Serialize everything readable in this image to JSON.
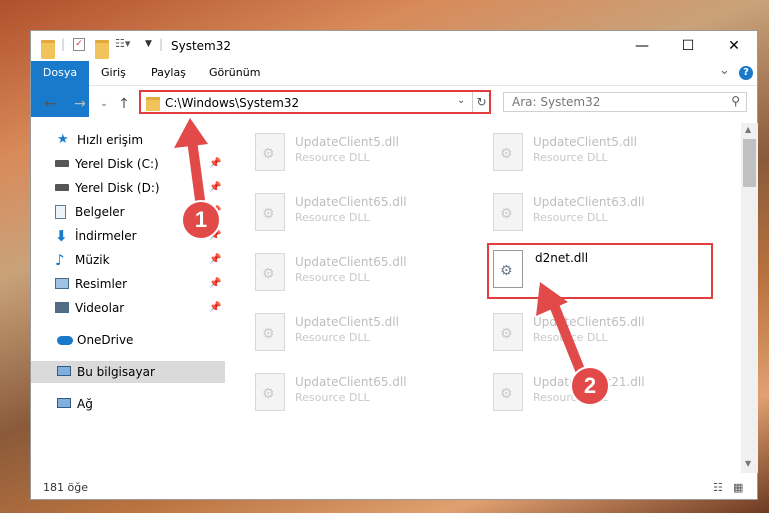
{
  "window": {
    "title": "System32",
    "controls": {
      "minimize": "—",
      "maximize": "☐",
      "close": "✕"
    }
  },
  "ribbon": {
    "tabs": [
      "Dosya",
      "Giriş",
      "Paylaş",
      "Görünüm"
    ],
    "collapse": "⌄",
    "help": "?"
  },
  "address": {
    "path": "C:\\Windows\\System32",
    "search_placeholder": "Ara: System32"
  },
  "sidebar": {
    "items": [
      {
        "label": "Hızlı erişim",
        "icon": "star-icon",
        "pinned": false
      },
      {
        "label": "Yerel Disk (C:)",
        "icon": "drive-icon",
        "pinned": true
      },
      {
        "label": "Yerel Disk (D:)",
        "icon": "drive-icon",
        "pinned": true
      },
      {
        "label": "Belgeler",
        "icon": "documents-icon",
        "pinned": true
      },
      {
        "label": "İndirmeler",
        "icon": "download-icon",
        "pinned": true
      },
      {
        "label": "Müzik",
        "icon": "music-icon",
        "pinned": true
      },
      {
        "label": "Resimler",
        "icon": "pictures-icon",
        "pinned": true
      },
      {
        "label": "Videolar",
        "icon": "video-icon",
        "pinned": true
      },
      {
        "label": "OneDrive",
        "icon": "cloud-icon",
        "pinned": false
      },
      {
        "label": "Bu bilgisayar",
        "icon": "computer-icon",
        "pinned": false
      },
      {
        "label": "Ağ",
        "icon": "network-icon",
        "pinned": false
      }
    ]
  },
  "files": [
    {
      "name": "UpdateClient5.dll",
      "type": "Resource DLL"
    },
    {
      "name": "UpdateClient5.dll",
      "type": "Resource DLL"
    },
    {
      "name": "UpdateClient65.dll",
      "type": "Resource DLL"
    },
    {
      "name": "UpdateClient63.dll",
      "type": "Resource DLL"
    },
    {
      "name": "UpdateClient65.dll",
      "type": "Resource DLL"
    },
    {
      "name": "d2net.dll",
      "type": ""
    },
    {
      "name": "UpdateClient5.dll",
      "type": "Resource DLL"
    },
    {
      "name": "UpdateClient65.dll",
      "type": "Resource DLL"
    },
    {
      "name": "UpdateClient65.dll",
      "type": "Resource DLL"
    },
    {
      "name": "UpdateClient21.dll",
      "type": "Resource DLL"
    }
  ],
  "status": {
    "count": "181 öğe"
  },
  "callouts": {
    "step1": "1",
    "step2": "2"
  },
  "colors": {
    "highlight": "#e23c3c",
    "file_tab": "#1979ca",
    "selection": "#cce4f7"
  }
}
